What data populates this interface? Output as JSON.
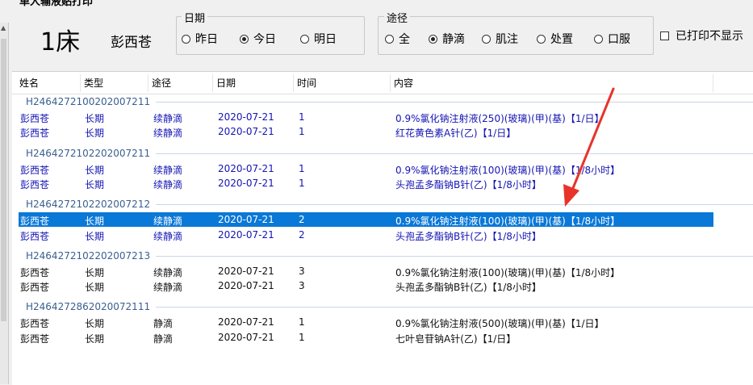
{
  "window": {
    "title": "单人输液贴打印"
  },
  "patient": {
    "bed": "1床",
    "name": "彭西苍"
  },
  "date_group": {
    "label": "日期",
    "options": [
      "昨日",
      "今日",
      "明日"
    ],
    "selected": "今日"
  },
  "route_group": {
    "label": "途径",
    "options": [
      "全",
      "静滴",
      "肌注",
      "处置",
      "口服"
    ],
    "selected": "静滴"
  },
  "printed_filter": {
    "label": "已打印不显示",
    "checked": false
  },
  "grid": {
    "columns": [
      "姓名",
      "类型",
      "途径",
      "日期",
      "时间",
      "内容"
    ],
    "groups": [
      {
        "id": "H2464272100202007211",
        "rows": [
          {
            "name": "彭西苍",
            "type": "长期",
            "route": "续静滴",
            "date": "2020-07-21",
            "time": "1",
            "content": "0.9%氯化钠注射液(250)(玻璃)(甲)(基)【1/日】",
            "style": "blue"
          },
          {
            "name": "彭西苍",
            "type": "长期",
            "route": "续静滴",
            "date": "2020-07-21",
            "time": "1",
            "content": "红花黄色素A针(乙)【1/日】",
            "style": "blue"
          }
        ]
      },
      {
        "id": "H2464272102202007211",
        "rows": [
          {
            "name": "彭西苍",
            "type": "长期",
            "route": "续静滴",
            "date": "2020-07-21",
            "time": "1",
            "content": "0.9%氯化钠注射液(100)(玻璃)(甲)(基)【1/8小时】",
            "style": "blue"
          },
          {
            "name": "彭西苍",
            "type": "长期",
            "route": "续静滴",
            "date": "2020-07-21",
            "time": "1",
            "content": "头孢孟多酯钠B针(乙)【1/8小时】",
            "style": "blue"
          }
        ]
      },
      {
        "id": "H2464272102202007212",
        "rows": [
          {
            "name": "彭西苍",
            "type": "长期",
            "route": "续静滴",
            "date": "2020-07-21",
            "time": "2",
            "content": "0.9%氯化钠注射液(100)(玻璃)(甲)(基)【1/8小时】",
            "style": "sel"
          },
          {
            "name": "彭西苍",
            "type": "长期",
            "route": "续静滴",
            "date": "2020-07-21",
            "time": "2",
            "content": "头孢孟多酯钠B针(乙)【1/8小时】",
            "style": "blue"
          }
        ]
      },
      {
        "id": "H2464272102202007213",
        "rows": [
          {
            "name": "彭西苍",
            "type": "长期",
            "route": "续静滴",
            "date": "2020-07-21",
            "time": "3",
            "content": "0.9%氯化钠注射液(100)(玻璃)(甲)(基)【1/8小时】",
            "style": "black"
          },
          {
            "name": "彭西苍",
            "type": "长期",
            "route": "续静滴",
            "date": "2020-07-21",
            "time": "3",
            "content": "头孢孟多酯钠B针(乙)【1/8小时】",
            "style": "black"
          }
        ]
      },
      {
        "id": "H2464272862020072111",
        "rows": [
          {
            "name": "彭西苍",
            "type": "长期",
            "route": "静滴",
            "date": "2020-07-21",
            "time": "1",
            "content": "0.9%氯化钠注射液(500)(玻璃)(甲)(基)【1/日】",
            "style": "black"
          },
          {
            "name": "彭西苍",
            "type": "长期",
            "route": "静滴",
            "date": "2020-07-21",
            "time": "1",
            "content": "七叶皂苷钠A针(乙)【1/日】",
            "style": "black"
          }
        ]
      }
    ]
  },
  "colors": {
    "selection": "#0a78d7",
    "active_text": "#1414b4",
    "annotation_arrow": "#e8332b"
  },
  "annotation": {
    "arrow-icon": "red arrow pointing to selected row"
  }
}
